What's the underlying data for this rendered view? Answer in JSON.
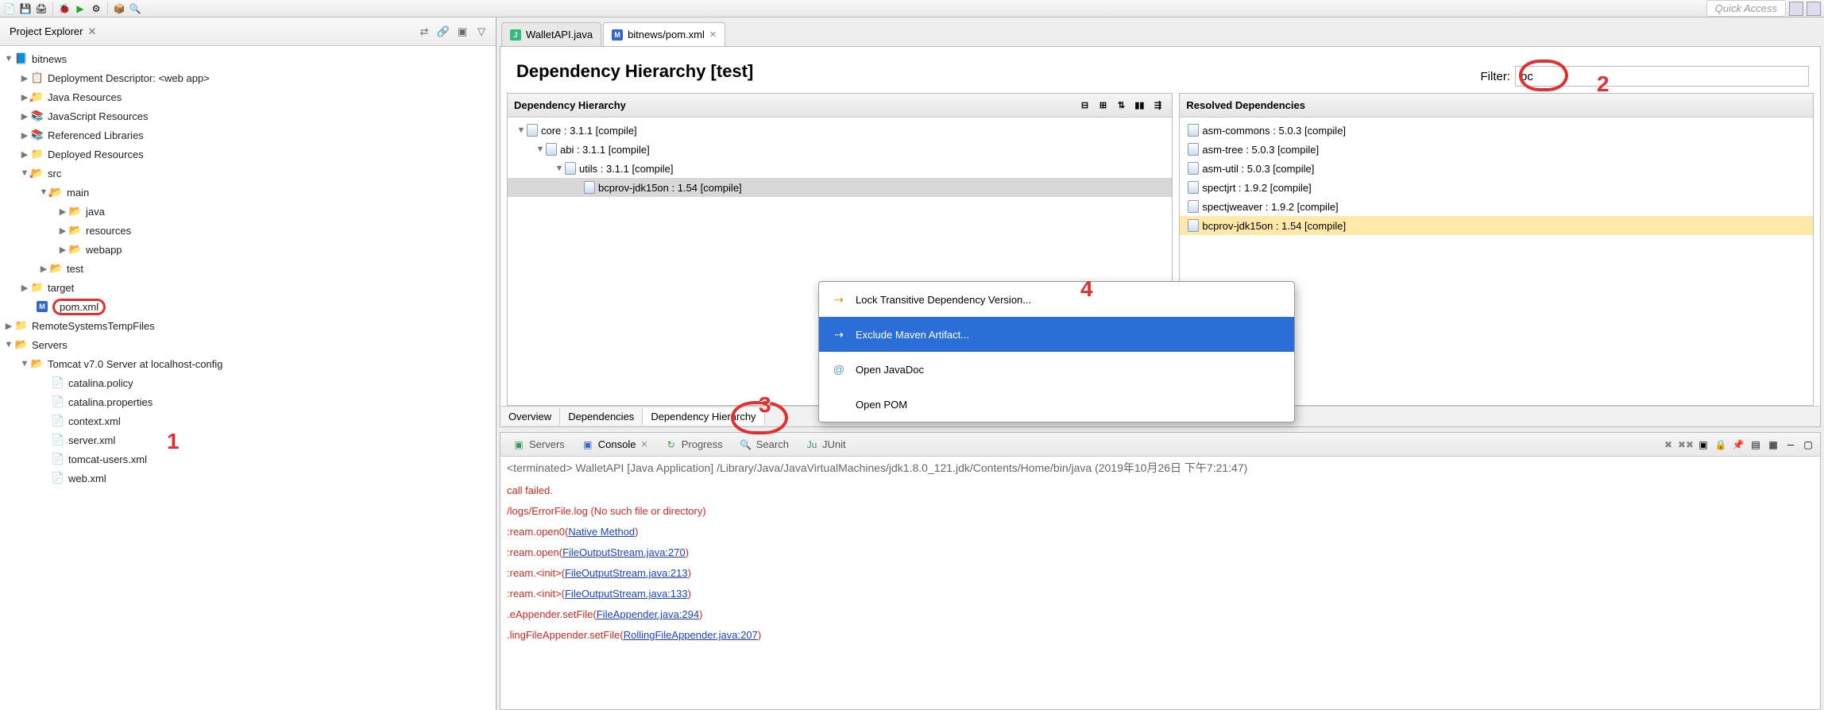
{
  "quick_access": "Quick Access",
  "left_panel": {
    "title": "Project Explorer",
    "tree": {
      "project": "bitnews",
      "deployment": "Deployment Descriptor: <web app>",
      "java_res": "Java Resources",
      "js_res": "JavaScript Resources",
      "ref_lib": "Referenced Libraries",
      "dep_res": "Deployed Resources",
      "src": "src",
      "main": "main",
      "java": "java",
      "resources": "resources",
      "webapp": "webapp",
      "test": "test",
      "target": "target",
      "pom": "pom.xml",
      "remote": "RemoteSystemsTempFiles",
      "servers": "Servers",
      "tomcat": "Tomcat v7.0 Server at localhost-config",
      "catalina_policy": "catalina.policy",
      "catalina_props": "catalina.properties",
      "context_xml": "context.xml",
      "server_xml": "server.xml",
      "tomcat_users": "tomcat-users.xml",
      "web_xml": "web.xml"
    }
  },
  "tabs": {
    "t1": "WalletAPI.java",
    "t2": "bitnews/pom.xml"
  },
  "dh": {
    "title": "Dependency Hierarchy [test]",
    "filter_label": "Filter:",
    "filter_value": "bc",
    "left_hdr": "Dependency Hierarchy",
    "right_hdr": "Resolved Dependencies",
    "tree": {
      "core": "core : 3.1.1 [compile]",
      "abi": "abi : 3.1.1 [compile]",
      "utils": "utils : 3.1.1 [compile]",
      "bcprov": "bcprov-jdk15on : 1.54 [compile]"
    },
    "resolved": {
      "r1": "asm-commons : 5.0.3 [compile]",
      "r2": "asm-tree : 5.0.3 [compile]",
      "r3": "asm-util : 5.0.3 [compile]",
      "r4": "spectjrt : 1.9.2 [compile]",
      "r5": "spectjweaver : 1.9.2 [compile]",
      "r6": "bcprov-jdk15on : 1.54 [compile]"
    }
  },
  "editor_tabs": {
    "overview": "Overview",
    "deps": "Dependencies",
    "deph": "Dependency Hierarchy"
  },
  "ctx": {
    "lock": "Lock Transitive Dependency Version...",
    "exclude": "Exclude Maven Artifact...",
    "javadoc": "Open JavaDoc",
    "pom": "Open POM"
  },
  "bottom": {
    "servers": "Servers",
    "console": "Console",
    "progress": "Progress",
    "search": "Search",
    "junit": "JUnit",
    "terminfo": "<terminated> WalletAPI [Java Application] /Library/Java/JavaVirtualMachines/jdk1.8.0_121.jdk/Contents/Home/bin/java (2019年10月26日 下午7:21:47)",
    "l1": "call failed.",
    "l2a": "/logs/ErrorFile.log (No such file or directory)",
    "l3a": ":ream.open0(",
    "l3b": "Native Method",
    "l3c": ")",
    "l4a": ":ream.open(",
    "l4b": "FileOutputStream.java:270",
    "l4c": ")",
    "l5a": ":ream.<init>(",
    "l5b": "FileOutputStream.java:213",
    "l5c": ")",
    "l6a": ":ream.<init>(",
    "l6b": "FileOutputStream.java:133",
    "l6c": ")",
    "l7a": ".eAppender.setFile(",
    "l7b": "FileAppender.java:294",
    "l7c": ")",
    "l8a": ".lingFileAppender.setFile(",
    "l8b": "RollingFileAppender.java:207",
    "l8c": ")"
  },
  "annotations": {
    "n1": "1",
    "n2": "2",
    "n3": "3",
    "n4": "4"
  }
}
